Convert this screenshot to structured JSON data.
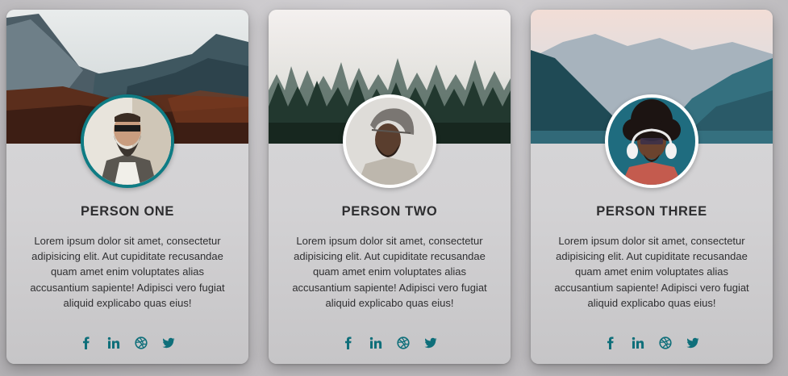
{
  "cards": [
    {
      "name": "PERSON ONE",
      "bio": "Lorem ipsum dolor sit amet, consectetur adipisicing elit. Aut cupiditate recusandae quam amet enim voluptates alias accusantium sapiente! Adipisci vero fugiat aliquid explicabo quas eius!",
      "banner": "mountain-valley-autumn",
      "avatar": "bearded-man-sunglasses",
      "socials": [
        "facebook-icon",
        "linkedin-icon",
        "dribbble-icon",
        "twitter-icon"
      ]
    },
    {
      "name": "PERSON TWO",
      "bio": "Lorem ipsum dolor sit amet, consectetur adipisicing elit. Aut cupiditate recusandae quam amet enim voluptates alias accusantium sapiente! Adipisci vero fugiat aliquid explicabo quas eius!",
      "banner": "misty-pine-forest",
      "avatar": "man-knit-beanie",
      "socials": [
        "facebook-icon",
        "linkedin-icon",
        "dribbble-icon",
        "twitter-icon"
      ]
    },
    {
      "name": "PERSON THREE",
      "bio": "Lorem ipsum dolor sit amet, consectetur adipisicing elit. Aut cupiditate recusandae quam amet enim voluptates alias accusantium sapiente! Adipisci vero fugiat aliquid explicabo quas eius!",
      "banner": "blue-mountain-lake",
      "avatar": "man-headphones-glasses",
      "socials": [
        "facebook-icon",
        "linkedin-icon",
        "dribbble-icon",
        "twitter-icon"
      ]
    }
  ],
  "colors": {
    "accent": "#0f6f7a",
    "avatar_ring_highlight": "#0f7c84",
    "card_bg": "#d6d5d7",
    "name_text": "#2e2e30",
    "body_text": "#2f2f31"
  }
}
